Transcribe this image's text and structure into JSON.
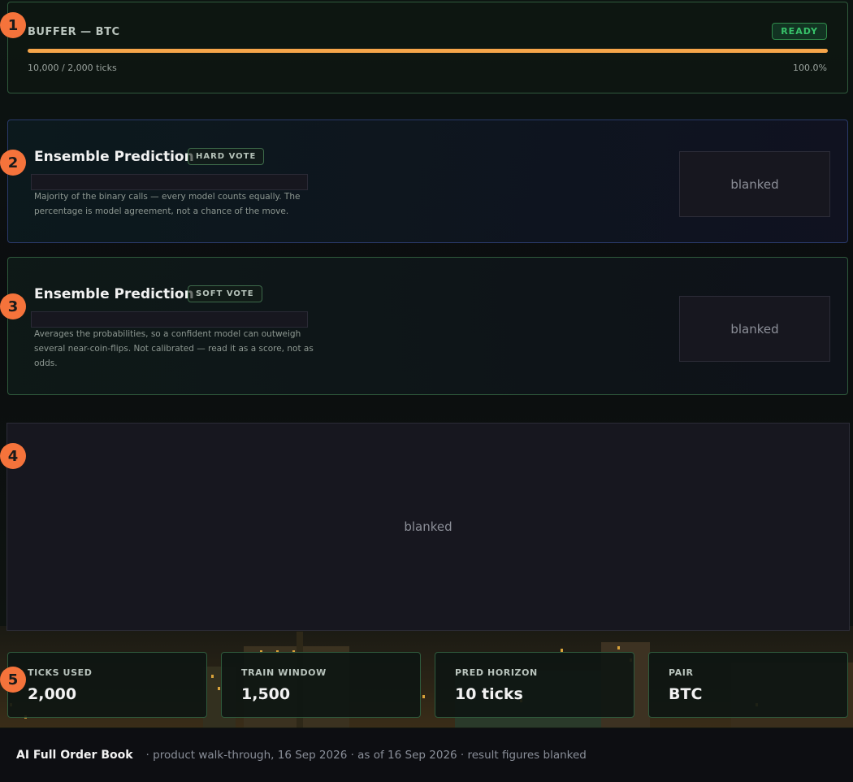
{
  "buffer": {
    "title": "BUFFER — BTC",
    "status": "READY",
    "ticks_text": "10,000 / 2,000 ticks",
    "percent_text": "100.0%",
    "progress": 1.0
  },
  "hard_vote": {
    "title": "Ensemble Prediction",
    "tag": "HARD VOTE",
    "description": "Majority of the binary calls — every model counts equally. The percentage is model agreement, not a chance of the move.",
    "result": "blanked"
  },
  "soft_vote": {
    "title": "Ensemble Prediction",
    "tag": "SOFT VOTE",
    "description": "Averages the probabilities, so a confident model can outweigh several near-coin-flips. Not calibrated — read it as a score, not as odds.",
    "result": "blanked"
  },
  "main_panel": {
    "result": "blanked"
  },
  "stats": [
    {
      "label": "TICKS USED",
      "value": "2,000"
    },
    {
      "label": "TRAIN WINDOW",
      "value": "1,500"
    },
    {
      "label": "PRED HORIZON",
      "value": "10 ticks"
    },
    {
      "label": "PAIR",
      "value": "BTC"
    }
  ],
  "markers": [
    "1",
    "2",
    "3",
    "4",
    "5"
  ],
  "footer": {
    "brand": "AI Full Order Book",
    "meta": "· product walk-through, 16 Sep 2026 · as of 16 Sep 2026 · result figures blanked"
  },
  "colors": {
    "accent_orange": "#f5a54a",
    "marker_orange": "#f5733b",
    "ready_green": "#38c26a",
    "panel_border": "#2f5a3c"
  }
}
